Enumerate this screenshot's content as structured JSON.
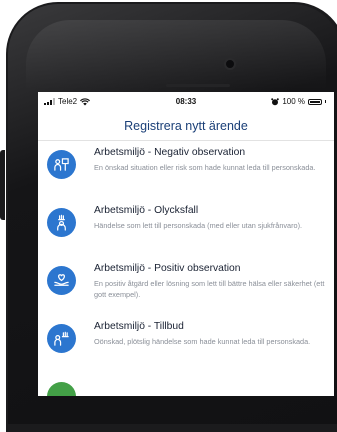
{
  "status_bar": {
    "carrier": "Tele2",
    "time": "08:33",
    "battery": "100 %"
  },
  "header": {
    "title": "Registrera nytt ärende"
  },
  "items": [
    {
      "title": "Arbetsmiljö - Negativ observation",
      "description": "En önskad situation eller risk som hade kunnat leda till personskada.",
      "icon": "negative-observation-icon"
    },
    {
      "title": "Arbetsmiljö - Olycksfall",
      "description": "Händelse som lett till personskada (med eller utan sjukfrånvaro).",
      "icon": "accident-icon"
    },
    {
      "title": "Arbetsmiljö - Positiv observation",
      "description": "En positiv åtgärd eller lösning som lett till bättre hälsa eller säkerhet (ett gott exempel).",
      "icon": "positive-observation-icon"
    },
    {
      "title": "Arbetsmiljö - Tillbud",
      "description": "Oönskad, plötslig händelse som hade kunnat leda till personskada.",
      "icon": "near-miss-icon"
    }
  ],
  "colors": {
    "accent": "#2c76cf",
    "title": "#1a3f77",
    "partial_item": "#43a047"
  }
}
